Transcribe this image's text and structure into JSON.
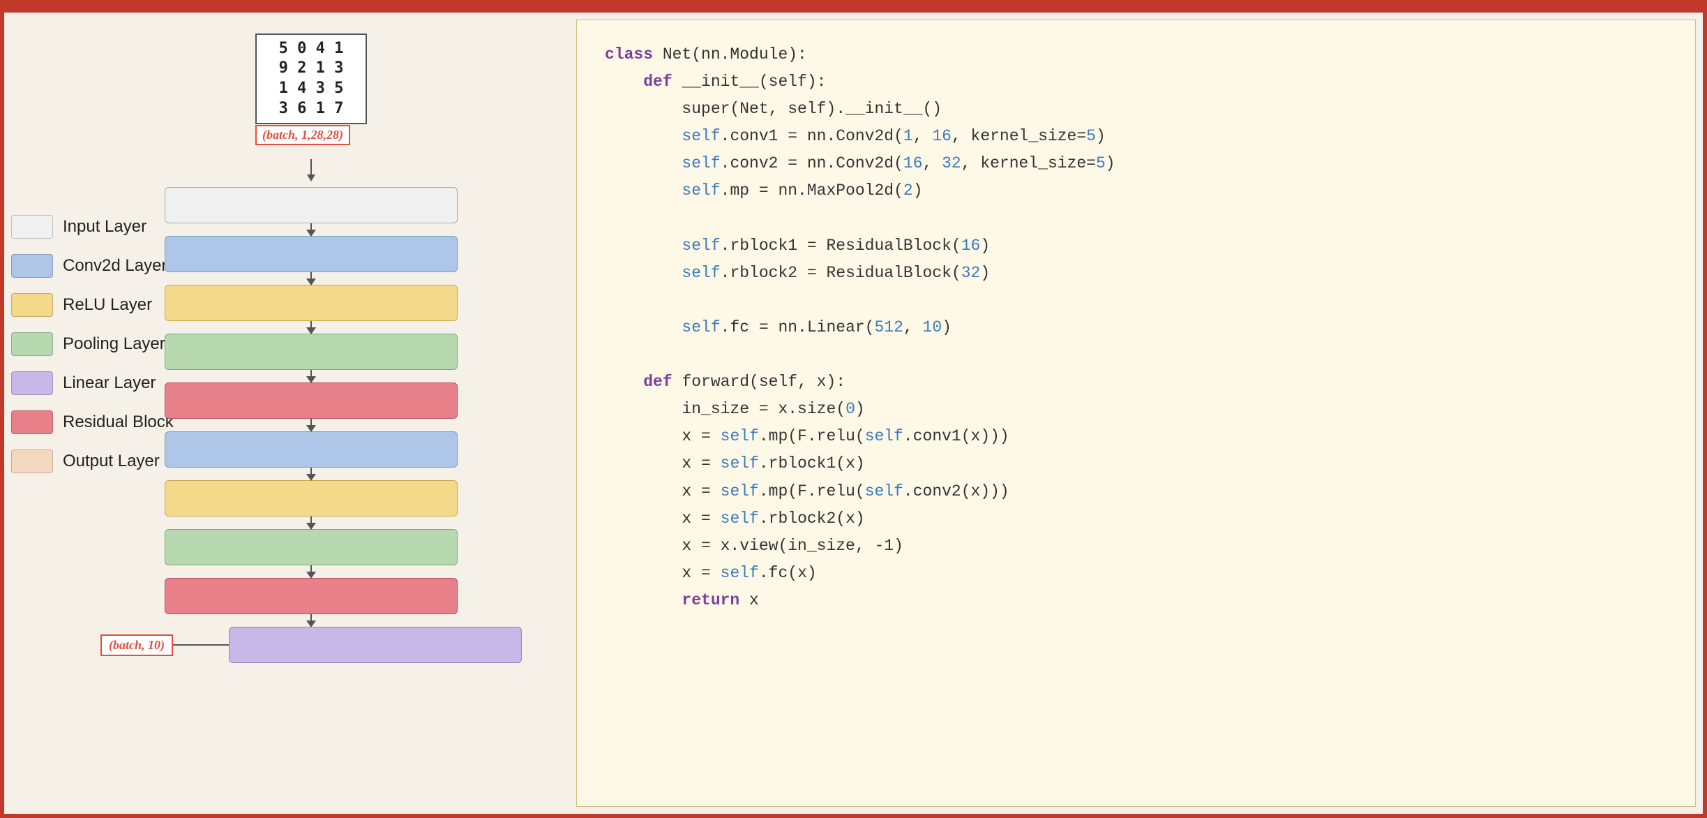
{
  "topbar": {
    "color": "#c0392b"
  },
  "diagram": {
    "mnist_numbers": "5 0 4 1\n9 2 1 3\n1 4 3 5\n3 6 1 7",
    "batch_top": "(batch, 1,28,28)",
    "batch_bottom": "(batch, 10)",
    "layers": [
      {
        "id": "input",
        "type": "layer-input"
      },
      {
        "id": "conv1",
        "type": "layer-conv"
      },
      {
        "id": "relu1",
        "type": "layer-relu"
      },
      {
        "id": "pool1",
        "type": "layer-pool"
      },
      {
        "id": "residual1",
        "type": "layer-residual"
      },
      {
        "id": "conv2",
        "type": "layer-conv"
      },
      {
        "id": "relu2",
        "type": "layer-relu"
      },
      {
        "id": "pool2",
        "type": "layer-pool"
      },
      {
        "id": "residual2",
        "type": "layer-residual"
      },
      {
        "id": "linear",
        "type": "layer-linear"
      }
    ]
  },
  "legend": {
    "items": [
      {
        "id": "input-legend",
        "type": "layer-input",
        "label": "Input Layer"
      },
      {
        "id": "conv-legend",
        "type": "layer-conv",
        "label": "Conv2d Layer"
      },
      {
        "id": "relu-legend",
        "type": "layer-relu",
        "label": "ReLU Layer"
      },
      {
        "id": "pool-legend",
        "type": "layer-pool",
        "label": "Pooling Layer"
      },
      {
        "id": "linear-legend",
        "type": "layer-linear",
        "label": "Linear Layer"
      },
      {
        "id": "residual-legend",
        "type": "layer-residual",
        "label": "Residual Block"
      },
      {
        "id": "output-legend",
        "type": "layer-output",
        "label": "Output Layer"
      }
    ]
  },
  "code": {
    "lines": [
      "class Net(nn.Module):",
      "    def __init__(self):",
      "        super(Net, self).__init__()",
      "        self.conv1 = nn.Conv2d(1, 16, kernel_size=5)",
      "        self.conv2 = nn.Conv2d(16, 32, kernel_size=5)",
      "        self.mp = nn.MaxPool2d(2)",
      "",
      "        self.rblock1 = ResidualBlock(16)",
      "        self.rblock2 = ResidualBlock(32)",
      "",
      "        self.fc = nn.Linear(512, 10)",
      "",
      "    def forward(self, x):",
      "        in_size = x.size(0)",
      "        x = self.mp(F.relu(self.conv1(x)))",
      "        x = self.rblock1(x)",
      "        x = self.mp(F.relu(self.conv2(x)))",
      "        x = self.rblock2(x)",
      "        x = x.view(in_size, -1)",
      "        x = self.fc(x)",
      "        return x"
    ]
  }
}
